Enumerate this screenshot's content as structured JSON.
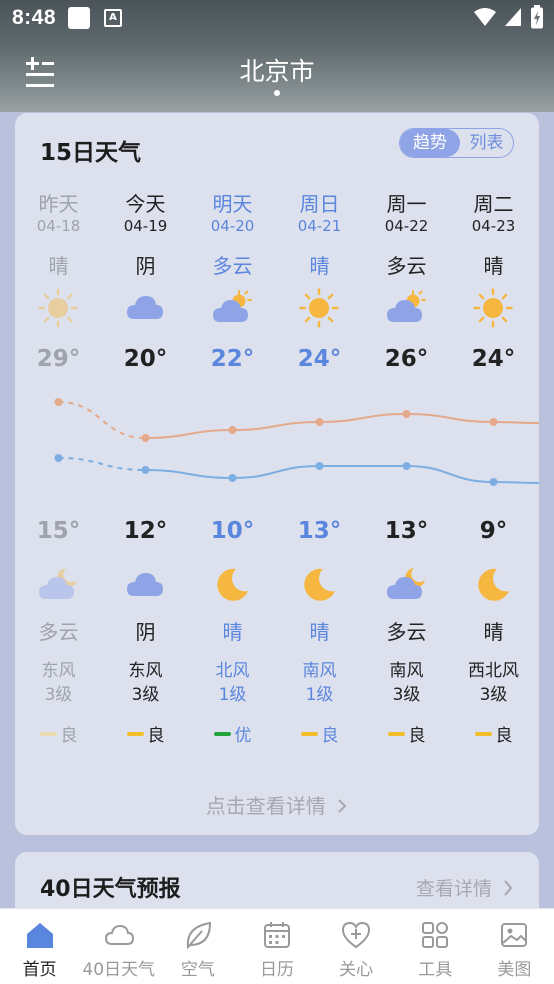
{
  "status_bar": {
    "time": "8:48",
    "notif_label": "A"
  },
  "header": {
    "city": "北京市"
  },
  "forecast15": {
    "title": "15日天气",
    "toggle": {
      "active": "趋势",
      "inactive": "列表"
    },
    "days": [
      {
        "day": "昨天",
        "date": "04-18",
        "day_weather": "晴",
        "day_icon": "sun-icon",
        "high": "29°",
        "low": "15°",
        "night_icon": "cloudy-night-icon",
        "night_weather": "多云",
        "wind": "东风",
        "wind_level": "3级",
        "aqi": "良",
        "aqi_color": "#eadbb0",
        "high_value": 29,
        "low_value": 15,
        "style": "past"
      },
      {
        "day": "今天",
        "date": "04-19",
        "day_weather": "阴",
        "day_icon": "overcast-icon",
        "high": "20°",
        "low": "12°",
        "night_icon": "overcast-icon",
        "night_weather": "阴",
        "wind": "东风",
        "wind_level": "3级",
        "aqi": "良",
        "aqi_color": "#f2be2b",
        "high_value": 20,
        "low_value": 12,
        "style": "norm"
      },
      {
        "day": "明天",
        "date": "04-20",
        "day_weather": "多云",
        "day_icon": "partly-cloudy-icon",
        "high": "22°",
        "low": "10°",
        "night_icon": "moon-icon",
        "night_weather": "晴",
        "wind": "北风",
        "wind_level": "1级",
        "aqi": "优",
        "aqi_color": "#22a33a",
        "high_value": 22,
        "low_value": 10,
        "style": "wk"
      },
      {
        "day": "周日",
        "date": "04-21",
        "day_weather": "晴",
        "day_icon": "sun-icon",
        "high": "24°",
        "low": "13°",
        "night_icon": "moon-icon",
        "night_weather": "晴",
        "wind": "南风",
        "wind_level": "1级",
        "aqi": "良",
        "aqi_color": "#f2be2b",
        "high_value": 24,
        "low_value": 13,
        "style": "wk"
      },
      {
        "day": "周一",
        "date": "04-22",
        "day_weather": "多云",
        "day_icon": "partly-cloudy-icon",
        "high": "26°",
        "low": "13°",
        "night_icon": "cloudy-night-icon",
        "night_weather": "多云",
        "wind": "南风",
        "wind_level": "3级",
        "aqi": "良",
        "aqi_color": "#f2be2b",
        "high_value": 26,
        "low_value": 13,
        "style": "norm"
      },
      {
        "day": "周二",
        "date": "04-23",
        "day_weather": "晴",
        "day_icon": "sun-icon",
        "high": "24°",
        "low": "9°",
        "night_icon": "moon-icon",
        "night_weather": "晴",
        "wind": "西北风",
        "wind_level": "3级",
        "aqi": "良",
        "aqi_color": "#f2be2b",
        "high_value": 24,
        "low_value": 9,
        "style": "norm"
      }
    ],
    "detail_link": "点击查看详情"
  },
  "forecast40": {
    "title": "40日天气预报",
    "more": "查看详情"
  },
  "tabbar": [
    {
      "label": "首页",
      "icon": "home-icon",
      "active": true
    },
    {
      "label": "40日天气",
      "icon": "cloud-icon",
      "active": false
    },
    {
      "label": "空气",
      "icon": "leaf-icon",
      "active": false
    },
    {
      "label": "日历",
      "icon": "calendar-icon",
      "active": false
    },
    {
      "label": "关心",
      "icon": "heart-plus-icon",
      "active": false
    },
    {
      "label": "工具",
      "icon": "tools-icon",
      "active": false
    },
    {
      "label": "美图",
      "icon": "image-icon",
      "active": false
    }
  ],
  "colors": {
    "accent": "#8ea4e6",
    "high_line": "#e3a98a",
    "low_line": "#7caee3",
    "card": "#dde1ee",
    "sun": "#f6b740",
    "cloud": "#8ea4e6"
  }
}
